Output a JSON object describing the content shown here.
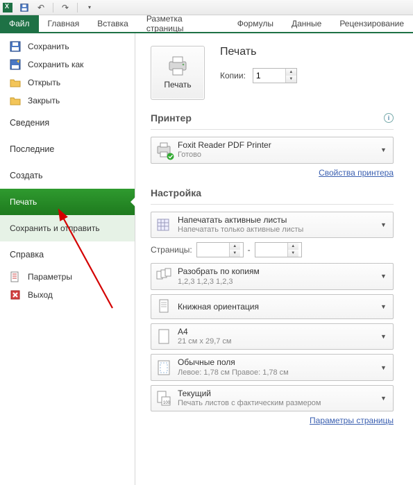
{
  "qat": {
    "save": "save",
    "undo": "undo",
    "redo": "redo"
  },
  "tabs": {
    "file": "Файл",
    "home": "Главная",
    "insert": "Вставка",
    "layout": "Разметка страницы",
    "formulas": "Формулы",
    "data": "Данные",
    "review": "Рецензирование"
  },
  "sidebar": {
    "save": "Сохранить",
    "saveas": "Сохранить как",
    "open": "Открыть",
    "close": "Закрыть",
    "info": "Сведения",
    "recent": "Последние",
    "create": "Создать",
    "print": "Печать",
    "saveSend": "Сохранить и отправить",
    "help": "Справка",
    "options": "Параметры",
    "exit": "Выход"
  },
  "print": {
    "header": "Печать",
    "button": "Печать",
    "copiesLabel": "Копии:",
    "copiesValue": "1"
  },
  "printer": {
    "section": "Принтер",
    "name": "Foxit Reader PDF Printer",
    "status": "Готово",
    "propsLink": "Свойства принтера"
  },
  "settings": {
    "section": "Настройка",
    "activeSheets": {
      "t1": "Напечатать активные листы",
      "t2": "Напечатать только активные листы"
    },
    "pagesLabel": "Страницы:",
    "pagesFrom": "",
    "pagesTo": "",
    "dash": "-",
    "collate": {
      "t1": "Разобрать по копиям",
      "t2": "1,2,3    1,2,3    1,2,3"
    },
    "orientation": {
      "t1": "Книжная ориентация"
    },
    "paper": {
      "t1": "A4",
      "t2": "21 см x 29,7 см"
    },
    "margins": {
      "t1": "Обычные поля",
      "t2": "Левое:  1,78 см    Правое:  1,78 см"
    },
    "scaling": {
      "t1": "Текущий",
      "t2": "Печать листов с фактическим размером"
    },
    "pageSetupLink": "Параметры страницы"
  }
}
